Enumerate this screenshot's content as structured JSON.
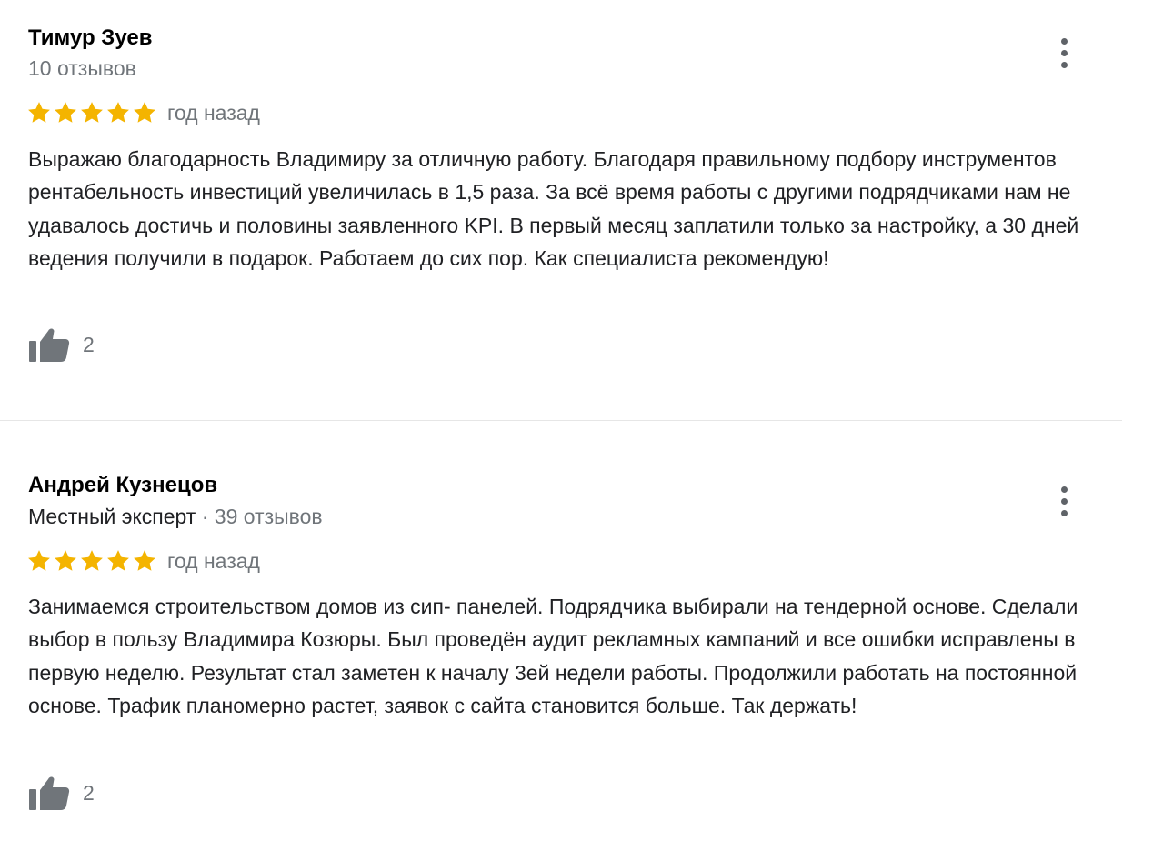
{
  "colors": {
    "star": "#f4b400",
    "icon": "#70757a",
    "divider": "#e6e6e6"
  },
  "reviews": [
    {
      "author": "Тимур Зуев",
      "badge": "",
      "reviews_count": "10 отзывов",
      "rating": 5,
      "date": "год назад",
      "text": "Выражаю благодарность Владимиру за отличную работу. Благодаря правильному подбору инструментов рентабельность инвестиций увеличилась в 1,5 раза. За всё время работы с другими подрядчиками нам не удавалось достичь и половины заявленного KPI. В первый месяц заплатили только за настройку, а 30 дней ведения получили в подарок. Работаем до сих пор. Как специалиста рекомендую!",
      "likes": "2",
      "like_icon": "thumbs-up-icon",
      "menu_icon": "more-vertical-icon"
    },
    {
      "author": "Андрей Кузнецов",
      "badge": "Местный эксперт",
      "reviews_count": " · 39 отзывов",
      "rating": 5,
      "date": "год назад",
      "text": "Занимаемся строительством домов из сип- панелей. Подрядчика выбирали на тендерной основе. Сделали выбор в пользу Владимира Козюры. Был проведён аудит рекламных кампаний и все ошибки исправлены в первую неделю. Результат стал заметен к началу 3ей недели работы. Продолжили работать на постоянной основе. Трафик планомерно растет, заявок с сайта становится больше. Так держать!",
      "likes": "2",
      "like_icon": "thumbs-up-icon",
      "menu_icon": "more-vertical-icon"
    }
  ]
}
